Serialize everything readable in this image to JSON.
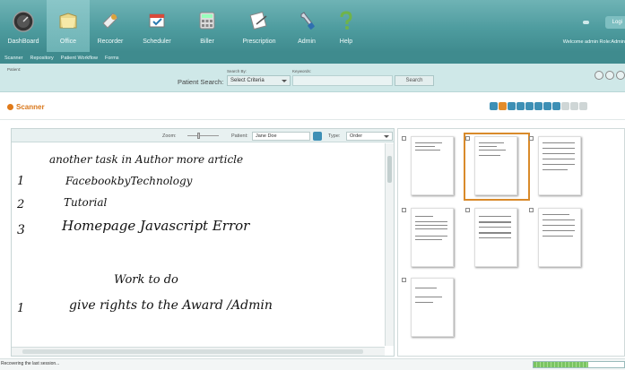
{
  "nav": {
    "items": [
      {
        "label": "DashBoard",
        "icon": "dashboard-gauge-icon"
      },
      {
        "label": "Office",
        "icon": "folder-icon",
        "active": true
      },
      {
        "label": "Recorder",
        "icon": "recorder-icon"
      },
      {
        "label": "Scheduler",
        "icon": "calendar-icon"
      },
      {
        "label": "Biller",
        "icon": "calculator-icon"
      },
      {
        "label": "Prescription",
        "icon": "prescription-icon"
      },
      {
        "label": "Admin",
        "icon": "wrench-icon"
      },
      {
        "label": "Help",
        "icon": "question-icon"
      }
    ],
    "logout": "Logi",
    "welcome": "Welcome admin  Role:Admin"
  },
  "subnav": [
    "Scanner",
    "Repository",
    "Patient Workflow",
    "Forms"
  ],
  "search": {
    "patient_small": "Patient:",
    "search_by_label": "Search By:",
    "keywords_label": "Keywords:",
    "patient_search_label": "Patient Search:",
    "select_value": "Select Criteria",
    "button": "Search"
  },
  "scanner": {
    "title": "Scanner",
    "zoom_label": "Zoom:",
    "patient_label": "Patient:",
    "patient_value": "Jane Doe",
    "type_label": "Type:",
    "type_value": "Order",
    "handwriting": [
      "another task    in Author more article",
      "FacebookbyTechnology",
      "Tutorial",
      "Homepage Javascript Error",
      "Work  to do",
      "give rights to the Award /Admin"
    ],
    "numerals": [
      "1",
      "2",
      "3",
      "1"
    ]
  },
  "status": {
    "text": "Recovering the last session...",
    "progress": 0.6
  },
  "colors": {
    "header": "#4e9c9f",
    "accent": "#e07a19",
    "toolbar_icon": "#3d8fb5",
    "progress": "#7ac462"
  }
}
